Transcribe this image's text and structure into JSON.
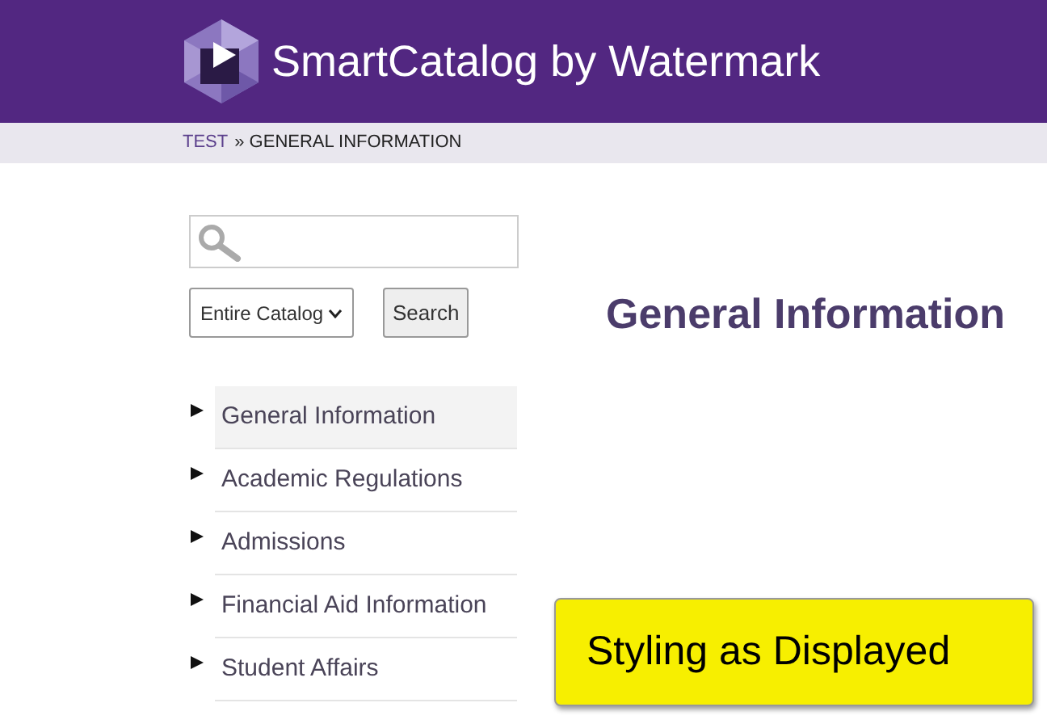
{
  "header": {
    "title": "SmartCatalog by Watermark"
  },
  "breadcrumb": [
    {
      "label": "TEST",
      "link": true
    },
    {
      "label": "» GENERAL INFORMATION",
      "link": false
    }
  ],
  "search": {
    "scope": "Entire Catalog",
    "button": "Search"
  },
  "nav": [
    {
      "label": "General Information",
      "selected": true
    },
    {
      "label": "Academic Regulations",
      "selected": false
    },
    {
      "label": "Admissions",
      "selected": false
    },
    {
      "label": "Financial Aid Information",
      "selected": false
    },
    {
      "label": "Student Affairs",
      "selected": false
    }
  ],
  "heading": "General Information",
  "overlay": {
    "label": "Styling as Displayed"
  }
}
